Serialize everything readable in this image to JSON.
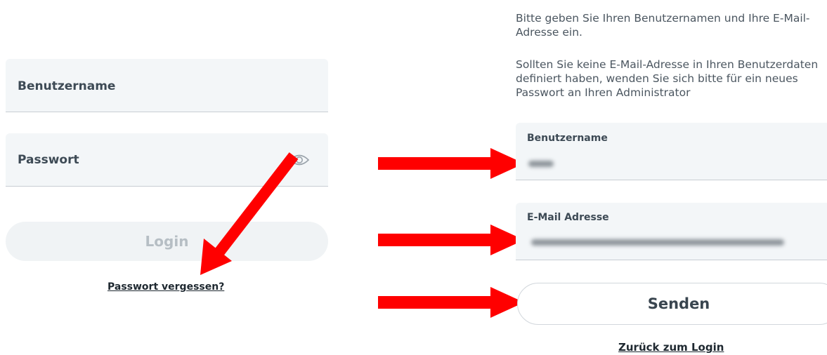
{
  "login": {
    "username_label": "Benutzername",
    "password_label": "Passwort",
    "login_button": "Login",
    "forgot_link": "Passwort vergessen?"
  },
  "reset": {
    "info_1": "Bitte geben Sie Ihren Benutzernamen und Ihre E-Mail-Adresse ein.",
    "info_2": "Sollten Sie keine E-Mail-Adresse in Ihren Benutzerdaten definiert haben, wenden Sie sich bitte für ein neues Passwort an Ihren Administrator",
    "username_label": "Benutzername",
    "email_label": "E-Mail Adresse",
    "send_button": "Senden",
    "back_link": "Zurück zum Login"
  },
  "icons": {
    "password_toggle": "eye-icon",
    "annotation": "red-arrow"
  },
  "colors": {
    "arrow": "#ff0000",
    "field_bg": "#f3f6f8",
    "label_text": "#3d4a55",
    "disabled_button_text": "#b6bec4"
  }
}
